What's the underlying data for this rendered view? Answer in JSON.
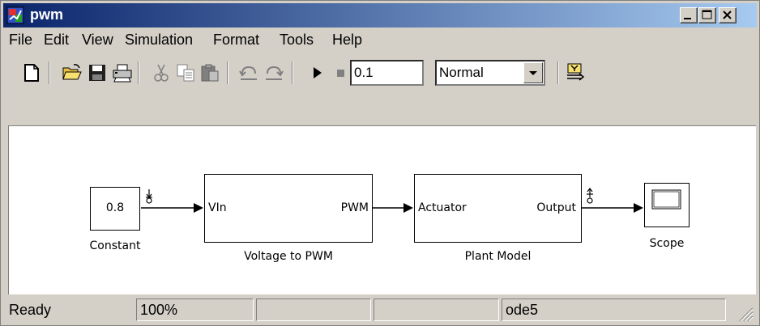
{
  "window": {
    "title": "pwm",
    "title_color_start": "#0a246a",
    "title_color_end": "#a6caf0"
  },
  "menu": {
    "items": [
      "File",
      "Edit",
      "View",
      "Simulation",
      "Format",
      "Tools",
      "Help"
    ]
  },
  "toolbar": {
    "icons": [
      "new-file-icon",
      "open-folder-icon",
      "save-icon",
      "print-icon",
      "cut-icon",
      "copy-icon",
      "paste-icon",
      "undo-icon",
      "redo-icon",
      "play-icon",
      "stop-icon",
      "library-browser-icon"
    ],
    "stop_time": "0.1",
    "sim_mode": "Normal"
  },
  "diagram": {
    "constant": {
      "value": "0.8",
      "name": "Constant"
    },
    "voltage_to_pwm": {
      "in_port": "VIn",
      "out_port": "PWM",
      "name": "Voltage to PWM"
    },
    "plant_model": {
      "in_port": "Actuator",
      "out_port": "Output",
      "name": "Plant Model"
    },
    "scope": {
      "name": "Scope"
    }
  },
  "status": {
    "state": "Ready",
    "zoom": "100%",
    "panel3": "",
    "panel4": "",
    "solver": "ode5"
  }
}
